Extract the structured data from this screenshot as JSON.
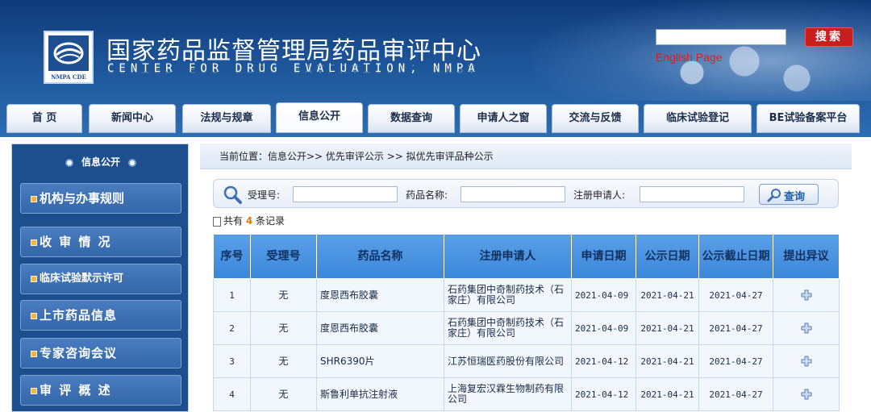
{
  "header": {
    "site_title_cn": "国家药品监督管理局药品审评中心",
    "site_title_en": "CENTER FOR DRUG EVALUATION, NMPA",
    "logo_caption": "NMPA CDE",
    "search_button": "搜索",
    "english_link": "English Page",
    "search_value": ""
  },
  "nav": {
    "tabs": [
      {
        "label": "首 页"
      },
      {
        "label": "新闻中心"
      },
      {
        "label": "法规与规章"
      },
      {
        "label": "信息公开"
      },
      {
        "label": "数据查询"
      },
      {
        "label": "申请人之窗"
      },
      {
        "label": "交流与反馈"
      },
      {
        "label": "临床试验登记"
      },
      {
        "label": "BE试验备案平台"
      }
    ],
    "active": "信息公开"
  },
  "sidebar": {
    "title": "信息公开",
    "items": [
      {
        "label": "机构与办事规则"
      },
      {
        "label": "收 审 情 况"
      },
      {
        "label": "临床试验默示许可"
      },
      {
        "label": "上市药品信息"
      },
      {
        "label": "专家咨询会议"
      },
      {
        "label": "审 评 概 述"
      }
    ]
  },
  "main": {
    "breadcrumb": "当前位置：信息公开>> 优先审评公示 >> 拟优先审评品种公示",
    "filter": {
      "accept_no_label": "受理号:",
      "drug_name_label": "药品名称:",
      "applicant_label": "注册申请人:",
      "accept_no_value": "",
      "drug_name_value": "",
      "applicant_value": "",
      "query_button": "查询"
    },
    "count": {
      "prefix": "共有",
      "number": "4",
      "suffix": "条记录"
    },
    "table": {
      "headers": [
        "序号",
        "受理号",
        "药品名称",
        "注册申请人",
        "申请日期",
        "公示日期",
        "公示截止日期",
        "提出异议"
      ],
      "rows": [
        {
          "no": "1",
          "accept_no": "无",
          "drug": "度恩西布胶囊",
          "applicant": "石药集团中奇制药技术（石家庄）有限公司",
          "apply_date": "2021-04-09",
          "pub_date": "2021-04-21",
          "deadline": "2021-04-27"
        },
        {
          "no": "2",
          "accept_no": "无",
          "drug": "度恩西布胶囊",
          "applicant": "石药集团中奇制药技术（石家庄）有限公司",
          "apply_date": "2021-04-09",
          "pub_date": "2021-04-21",
          "deadline": "2021-04-27"
        },
        {
          "no": "3",
          "accept_no": "无",
          "drug": "SHR6390片",
          "applicant": "江苏恒瑞医药股份有限公司",
          "apply_date": "2021-04-12",
          "pub_date": "2021-04-21",
          "deadline": "2021-04-27"
        },
        {
          "no": "4",
          "accept_no": "无",
          "drug": "斯鲁利单抗注射液",
          "applicant": "上海复宏汉霖生物制药有限公司",
          "apply_date": "2021-04-12",
          "pub_date": "2021-04-21",
          "deadline": "2021-04-27"
        }
      ]
    }
  },
  "colors": {
    "header_blue": "#1d5498",
    "search_red": "#c81e1e",
    "count_orange": "#e07a00",
    "table_header": "#3a86d8"
  },
  "icons": {
    "search": "magnifier-icon",
    "objection": "plus-icon",
    "list": "document-icon"
  }
}
